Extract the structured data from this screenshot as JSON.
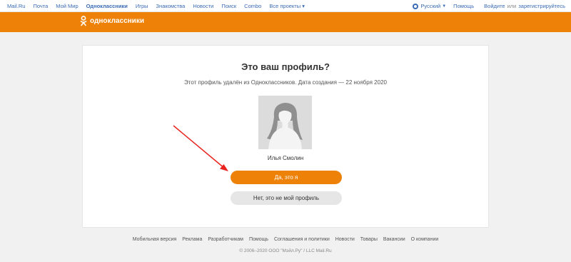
{
  "topbar": {
    "nav": [
      "Mail.Ru",
      "Почта",
      "Мой Мир",
      "Одноклассники",
      "Игры",
      "Знакомства",
      "Новости",
      "Поиск",
      "Combo",
      "Все проекты"
    ],
    "language": "Русский",
    "help": "Помощь",
    "login": "Войдите",
    "or": "или",
    "register": "зарегистрируйтесь"
  },
  "header": {
    "logo_text": "одноклассники",
    "color": "#ee8208"
  },
  "profile": {
    "title": "Это ваш профиль?",
    "subtitle": "Этот профиль удалён из Одноклассников. Дата создания — 22 ноября 2020",
    "name": "Илья Смолин",
    "confirm_button": "Да, это я",
    "deny_button": "Нет, это не мой профиль"
  },
  "footer": {
    "links": [
      "Мобильная версия",
      "Реклама",
      "Разработчикам",
      "Помощь",
      "Соглашения и политики",
      "Новости",
      "Товары",
      "Вакансии",
      "О компании"
    ],
    "copyright": "© 2006–2020 ООО \"Мэйл.Ру\" / LLC Mail.Ru"
  },
  "annotation": {
    "arrow_color": "#e8231f"
  }
}
